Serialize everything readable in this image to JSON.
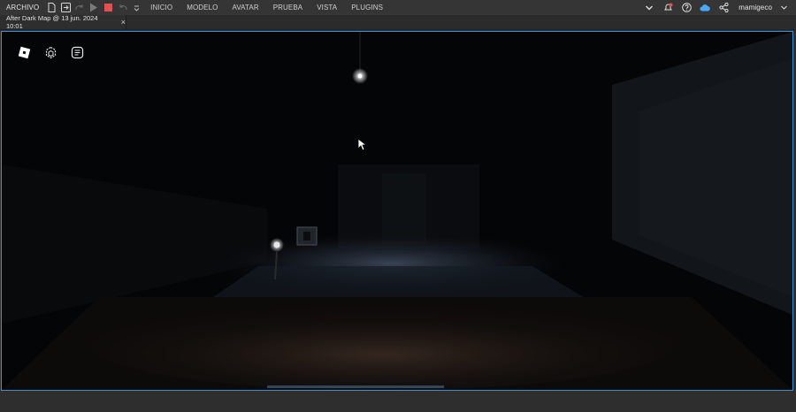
{
  "menubar": {
    "file_label": "ARCHIVO",
    "tabs": [
      "INICIO",
      "MODELO",
      "AVATAR",
      "PRUEBA",
      "VISTA",
      "PLUGINS"
    ],
    "user": "mamigeco",
    "icons": [
      "new-file-icon",
      "import-icon",
      "redo-icon",
      "play-icon",
      "stop-icon",
      "undo-icon",
      "chevron-icon",
      "notification-icon",
      "help-icon",
      "cloud-icon",
      "share-icon"
    ]
  },
  "tab": {
    "title": "After Dark Map @ 13 jun. 2024 10:01",
    "close": "×"
  },
  "viewport": {
    "tools": [
      "roblox-logo-icon",
      "cube-icon",
      "chat-icon"
    ]
  },
  "colors": {
    "viewport_border": "#3a8fd6",
    "stop_red": "#e05252",
    "cloud_blue": "#4aa8ff"
  }
}
